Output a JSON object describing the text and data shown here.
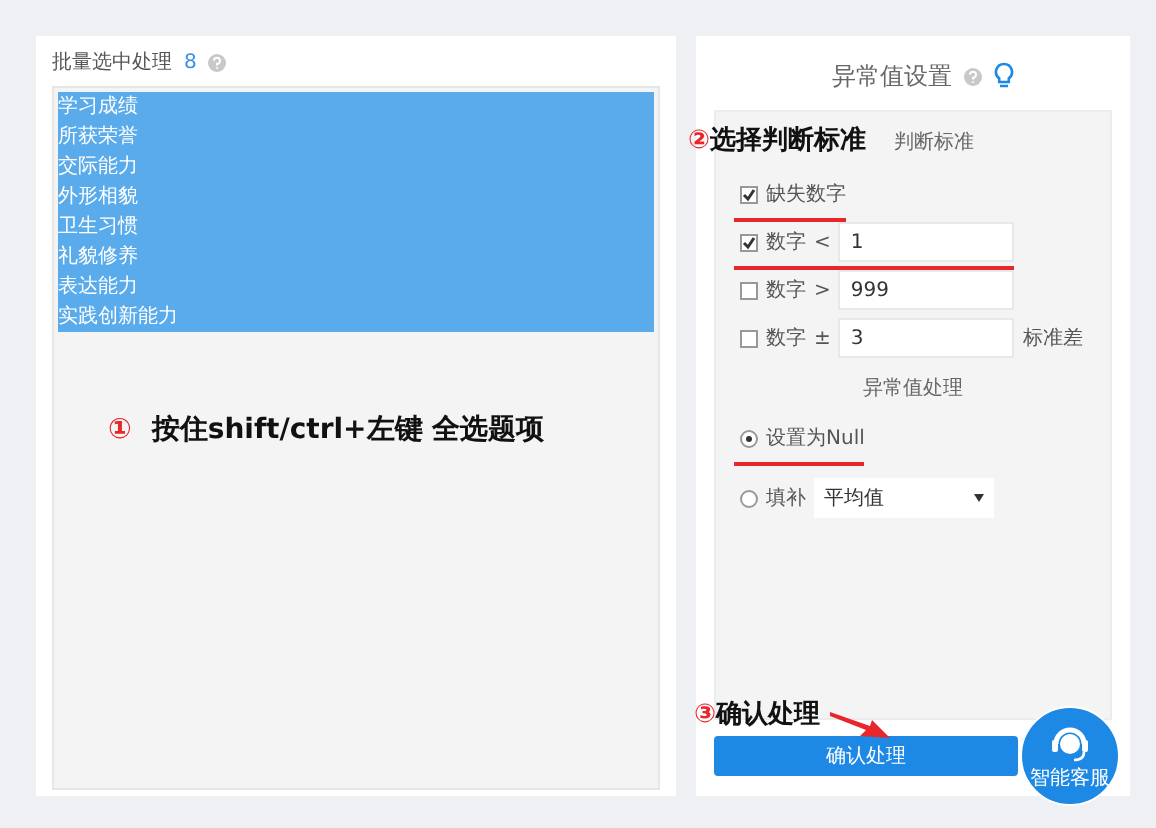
{
  "left": {
    "title": "批量选中处理",
    "count": "8",
    "items": [
      {
        "label": "学习成绩",
        "selected": true
      },
      {
        "label": "所获荣誉",
        "selected": true
      },
      {
        "label": "交际能力",
        "selected": true
      },
      {
        "label": "外形相貌",
        "selected": true
      },
      {
        "label": "卫生习惯",
        "selected": true
      },
      {
        "label": "礼貌修养",
        "selected": true
      },
      {
        "label": "表达能力",
        "selected": true
      },
      {
        "label": "实践创新能力",
        "selected": true
      }
    ],
    "hint_number": "①",
    "hint": "按住shift/ctrl+左键 全选题项"
  },
  "right": {
    "title": "异常值设置",
    "criteria_number": "②",
    "criteria_note": "选择判断标准",
    "criteria_label": "判断标准",
    "rows": [
      {
        "kind": "check",
        "checked": true,
        "label": "缺失数字",
        "underlined": true
      },
      {
        "kind": "compare",
        "checked": true,
        "label": "数字",
        "op": "<",
        "value": "1",
        "underlined": true
      },
      {
        "kind": "compare",
        "checked": false,
        "label": "数字",
        "op": ">",
        "value": "999",
        "underlined": false
      },
      {
        "kind": "compare",
        "checked": false,
        "label": "数字",
        "op": "±",
        "value": "3",
        "suffix": "标准差",
        "underlined": false
      }
    ],
    "handling_label": "异常值处理",
    "options": [
      {
        "kind": "radio",
        "label": "设置为Null",
        "selected": true,
        "underlined": true
      },
      {
        "kind": "fill",
        "label": "填补",
        "selected": false,
        "value": "平均值",
        "underlined": false
      }
    ],
    "confirm_number": "③",
    "confirm_note": "确认处理",
    "confirm_button": "确认处理",
    "support_label": "智能客服"
  }
}
